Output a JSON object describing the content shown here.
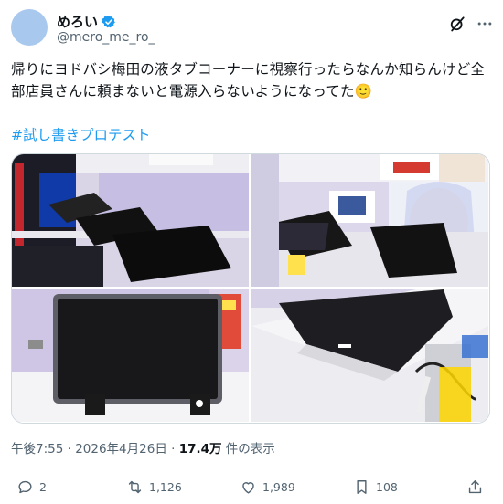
{
  "author": {
    "display_name": "めろい",
    "handle": "@mero_me_ro_"
  },
  "tweet": {
    "text_line1": "帰りにヨドバシ梅田の液タブコーナーに視察行ったらなんか知らんけど全",
    "text_line2": "部店員さんに頼まないと電源入らないようになってた🙂",
    "hashtag": "#試し書きプロテスト"
  },
  "meta": {
    "time": "午後7:55",
    "separator": " · ",
    "date": "2026年4月26日",
    "views_count": "17.4万",
    "views_label": " 件の表示"
  },
  "actions": {
    "replies": "2",
    "reposts": "1,126",
    "likes": "1,989",
    "bookmarks": "108"
  },
  "colors": {
    "accent": "#1d9bf0",
    "secondary_text": "#536471",
    "primary_text": "#0f1419"
  }
}
